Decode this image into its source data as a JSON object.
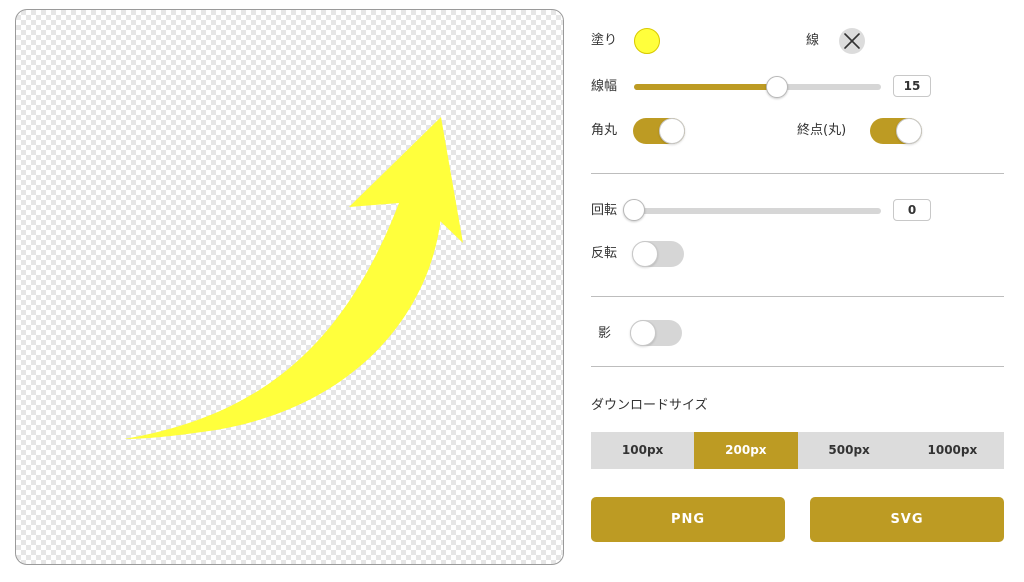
{
  "accent_color": "#bd9b23",
  "canvas": {
    "background": "transparent-checkerboard",
    "shape": "curved-arrow",
    "shape_fill": "#ffff3c"
  },
  "fill": {
    "label": "塗り",
    "color": "#ffff3c"
  },
  "stroke": {
    "label": "線",
    "value_icon": "x-icon",
    "color": "none"
  },
  "stroke_width": {
    "label": "線幅",
    "value": "15",
    "slider_fraction": 0.58
  },
  "round_corner": {
    "label": "角丸",
    "on": true
  },
  "round_cap": {
    "label": "終点(丸)",
    "on": true
  },
  "rotation": {
    "label": "回転",
    "value": "0",
    "slider_fraction": 0.0
  },
  "flip": {
    "label": "反転",
    "on": false
  },
  "shadow": {
    "label": "影",
    "on": false
  },
  "download_size": {
    "label": "ダウンロードサイズ",
    "options": [
      "100px",
      "200px",
      "500px",
      "1000px"
    ],
    "selected": "200px"
  },
  "buttons": {
    "png": "PNG",
    "svg": "SVG"
  }
}
